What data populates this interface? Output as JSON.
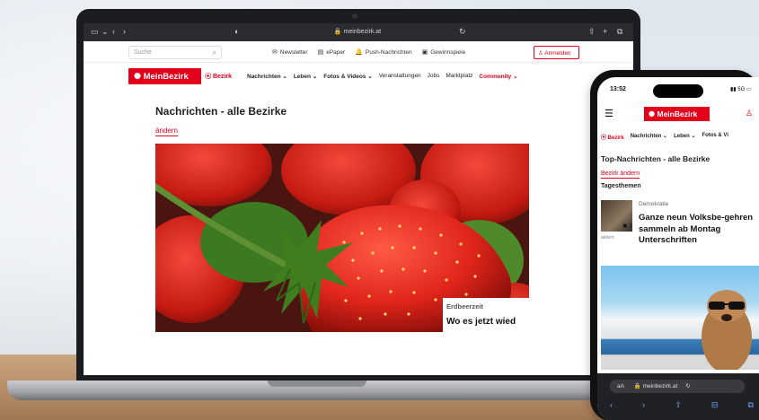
{
  "laptop": {
    "browser": {
      "url": "meinbezirk.at",
      "icons": [
        "sidebar-icon",
        "back-icon",
        "forward-icon",
        "shield-icon",
        "lock-icon",
        "reload-icon",
        "share-icon",
        "new-tab-icon",
        "tabs-icon"
      ]
    },
    "topbar": {
      "search_placeholder": "Suche",
      "links": [
        {
          "icon": "✉",
          "label": "Newsletter"
        },
        {
          "icon": "▤",
          "label": "ePaper"
        },
        {
          "icon": "🔔",
          "label": "Push-Nachrichten"
        },
        {
          "icon": "▣",
          "label": "Gewinnspiele"
        }
      ],
      "login_label": "Anmelden"
    },
    "nav": {
      "logo": "MeinBezirk",
      "bezirk": "Bezirk",
      "items": [
        {
          "label": "Nachrichten ⌄"
        },
        {
          "label": "Leben ⌄"
        },
        {
          "label": "Fotos & Videos ⌄"
        },
        {
          "label": "Veranstaltungen"
        },
        {
          "label": "Jobs"
        },
        {
          "label": "Marktplatz"
        },
        {
          "label": "Community ⌄"
        }
      ]
    },
    "main": {
      "headline": "Nachrichten - alle Bezirke",
      "change_link": "ändern",
      "hero": {
        "category": "Erdbeerzeit",
        "title": "Wo es jetzt wied"
      }
    }
  },
  "phone": {
    "status": {
      "time": "13:52",
      "indicators": "▮▮ 5G ▭"
    },
    "logo": "MeinBezirk",
    "nav": [
      "Bezirk",
      "Nachrichten ⌄",
      "Leben ⌄",
      "Fotos & Vi"
    ],
    "title": "Top-Nachrichten - alle Bezirke",
    "change_link": "Bezirk ändern",
    "section": "Tagesthemen",
    "article": {
      "category": "Demokratie",
      "title": "Ganze neun Volksbe-gehren sammeln ab Montag Unterschriften",
      "image_count": "▣ 3",
      "footer": "aktion"
    },
    "url_bar": {
      "text_size": "aA",
      "url": "meinbezirk.at"
    }
  },
  "colors": {
    "brand_red": "#e3001b"
  }
}
